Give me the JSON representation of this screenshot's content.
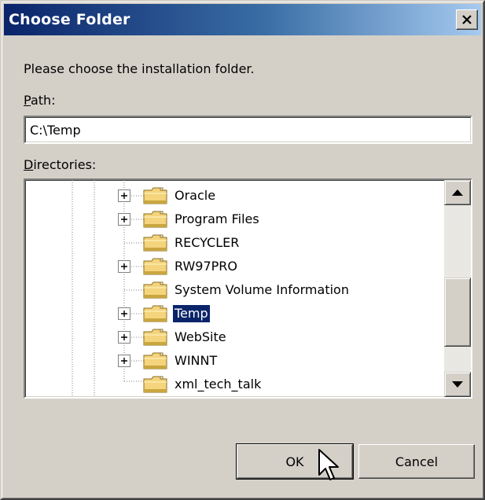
{
  "window": {
    "title": "Choose Folder",
    "close_icon": "close-icon"
  },
  "prompt": "Please choose the installation folder.",
  "path": {
    "label_accel": "P",
    "label_rest": "ath:",
    "value": "C:\\Temp"
  },
  "directories": {
    "label_accel": "D",
    "label_rest": "irectories:",
    "items": [
      {
        "label": "Oracle",
        "expandable": true,
        "selected": false
      },
      {
        "label": "Program Files",
        "expandable": true,
        "selected": false
      },
      {
        "label": "RECYCLER",
        "expandable": false,
        "selected": false
      },
      {
        "label": "RW97PRO",
        "expandable": true,
        "selected": false
      },
      {
        "label": "System Volume Information",
        "expandable": false,
        "selected": false
      },
      {
        "label": "Temp",
        "expandable": true,
        "selected": true
      },
      {
        "label": "WebSite",
        "expandable": true,
        "selected": false
      },
      {
        "label": "WINNT",
        "expandable": true,
        "selected": false
      },
      {
        "label": "xml_tech_talk",
        "expandable": false,
        "selected": false
      }
    ]
  },
  "buttons": {
    "ok": "OK",
    "cancel": "Cancel"
  },
  "colors": {
    "title_bar": "#0a246a",
    "face": "#d4d0c8",
    "selection": "#0a246a",
    "folder": "#f4d47c"
  }
}
